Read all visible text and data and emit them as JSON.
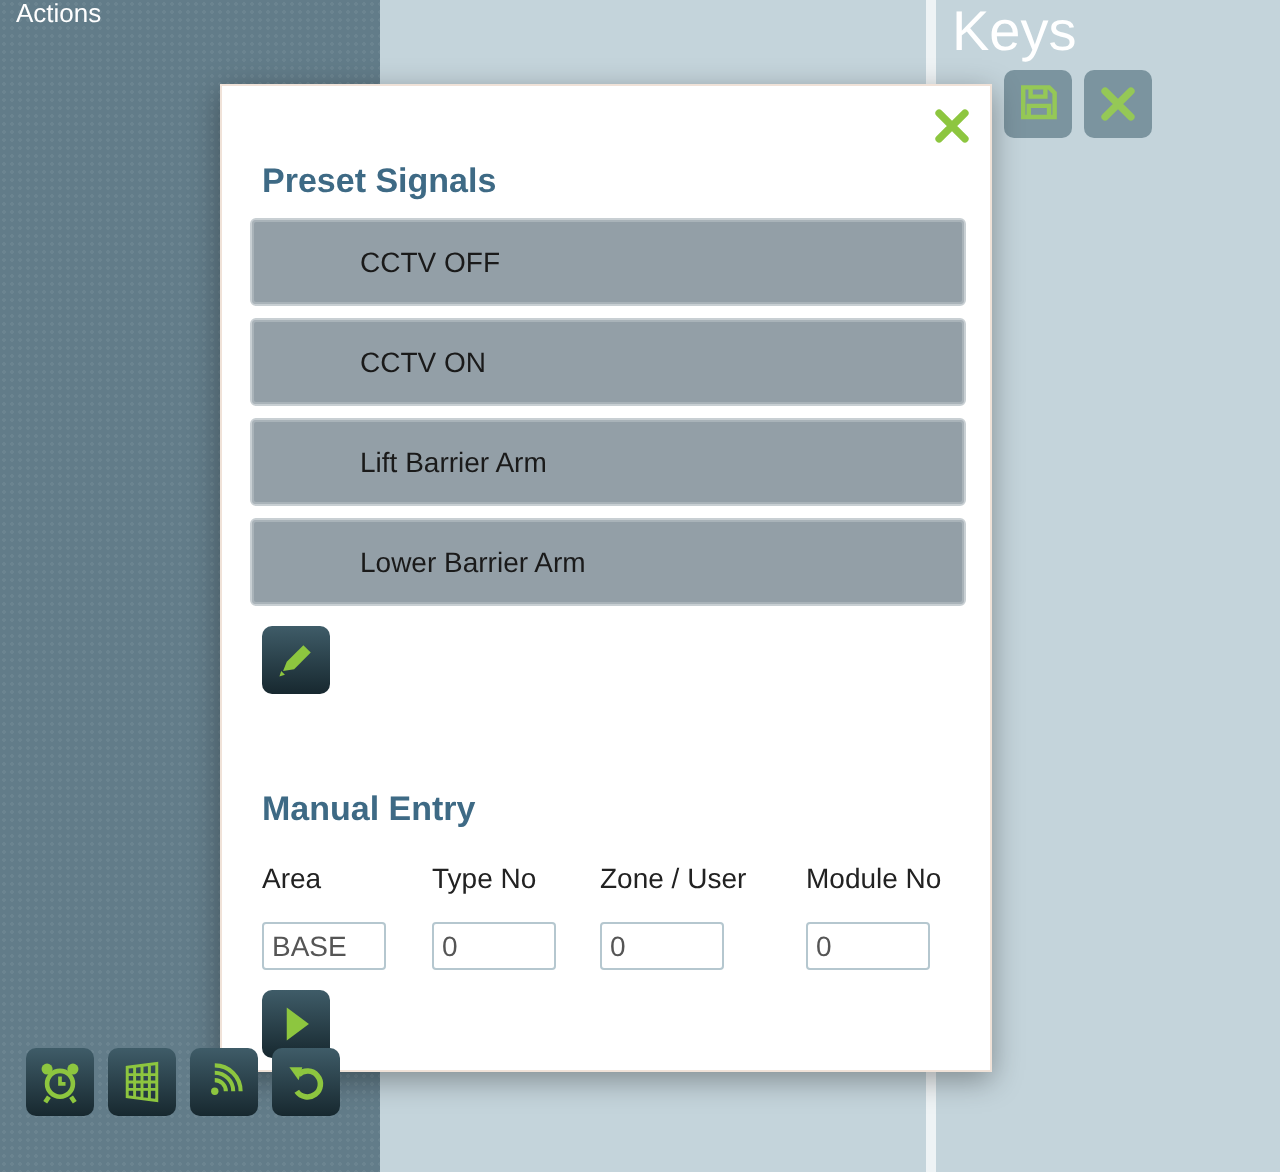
{
  "background": {
    "sidebar_title": "Actions",
    "page_title": "Keys",
    "header_buttons": [
      {
        "kind": "save"
      },
      {
        "kind": "close"
      }
    ],
    "tool_buttons": [
      {
        "kind": "alarm"
      },
      {
        "kind": "grid"
      },
      {
        "kind": "signal"
      },
      {
        "kind": "undo"
      }
    ]
  },
  "dialog": {
    "close": {
      "kind": "close"
    },
    "preset_heading": "Preset Signals",
    "presets": [
      "CCTV OFF",
      "CCTV ON",
      "Lift Barrier Arm",
      "Lower Barrier Arm"
    ],
    "edit_button": {
      "kind": "edit"
    },
    "manual_heading": "Manual Entry",
    "fields": [
      {
        "label": "Area",
        "value": "BASE"
      },
      {
        "label": "Type No",
        "value": "0"
      },
      {
        "label": "Zone / User",
        "value": "0"
      },
      {
        "label": "Module No",
        "value": "0"
      }
    ],
    "send_button": {
      "kind": "play"
    }
  }
}
